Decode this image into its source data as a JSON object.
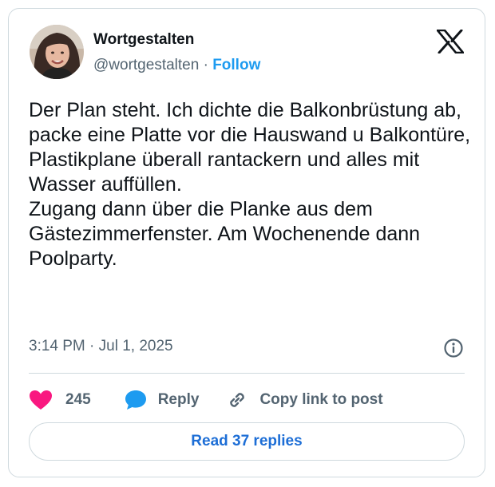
{
  "author": {
    "display_name": "Wortgestalten",
    "handle": "@wortgestalten",
    "separator": " · ",
    "follow_label": "Follow"
  },
  "tweet": {
    "text": "Der Plan steht. Ich dichte die Balkonbrüstung ab, packe eine Platte vor die Hauswand u Balkontüre, Plastikplane überall rantackern und alles mit Wasser auffüllen.\nZugang dann über die Planke aus dem Gästezimmerfenster. Am Wochenende dann Poolparty.",
    "timestamp": "3:14 PM · Jul 1, 2025"
  },
  "actions": {
    "like_count": "245",
    "reply_label": "Reply",
    "copy_link_label": "Copy link to post"
  },
  "read_replies_label": "Read 37 replies",
  "icons": {
    "platform": "x-logo-icon",
    "info": "info-icon",
    "like": "heart-icon",
    "reply": "speech-bubble-icon",
    "copy": "link-icon"
  },
  "colors": {
    "accent": "#1d9bf0",
    "like": "#f91880",
    "text": "#0f1419",
    "muted": "#536471",
    "border": "#cfd9de"
  }
}
